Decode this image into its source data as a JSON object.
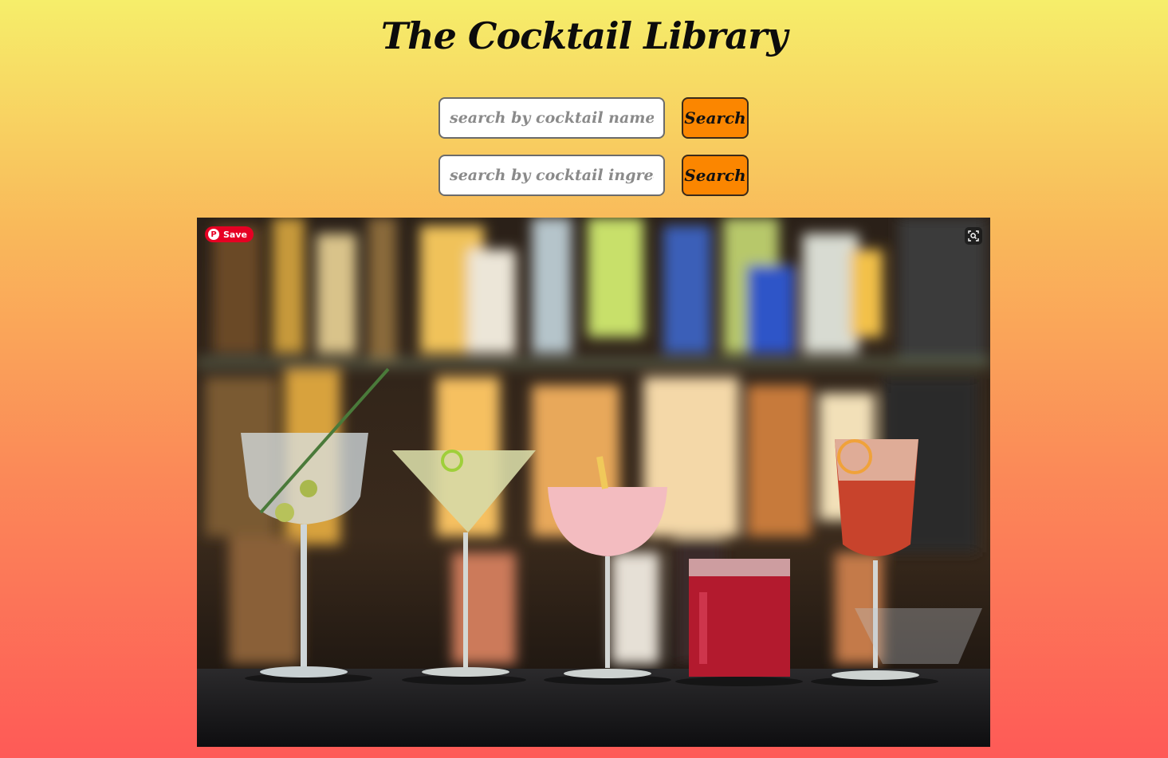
{
  "header": {
    "title": "The Cocktail Library"
  },
  "search": {
    "name_placeholder": "search by cocktail name",
    "ingredient_placeholder": "search by cocktail ingredient",
    "button_label": "Search"
  },
  "hero": {
    "pin_save_label": "Save",
    "pin_icon": "pinterest-icon",
    "lens_icon": "visual-search-icon"
  },
  "colors": {
    "gradient_top": "#f6ee6a",
    "gradient_bottom": "#fe5a57",
    "button": "#fb8600",
    "pinterest": "#e60023"
  }
}
